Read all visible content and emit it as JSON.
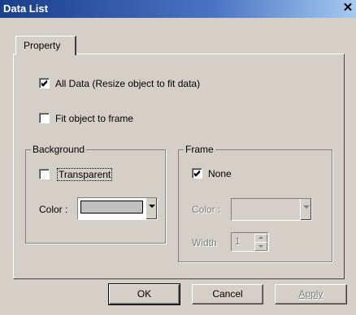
{
  "window": {
    "title": "Data List",
    "close_glyph": "✕"
  },
  "tabs": [
    {
      "label": "Property",
      "active": true
    }
  ],
  "options": {
    "all_data": {
      "label": "All Data (Resize object to fit data)",
      "checked": true
    },
    "fit_object": {
      "label": "Fit object to frame",
      "checked": false
    }
  },
  "background": {
    "title": "Background",
    "transparent": {
      "label": "Transparent",
      "checked": false
    },
    "color_label": "Color :",
    "color_value": "#c0c0c0"
  },
  "frame": {
    "title": "Frame",
    "none": {
      "label": "None",
      "checked": true
    },
    "color_label": "Color :",
    "width_label": "Width",
    "width_value": "1"
  },
  "buttons": {
    "ok": "OK",
    "cancel": "Cancel",
    "apply": "Apply"
  }
}
